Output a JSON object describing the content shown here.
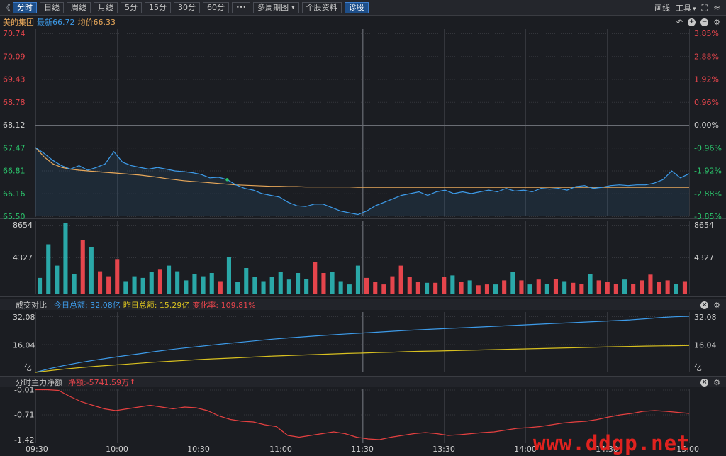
{
  "toolbar": {
    "collapse_glyph": "《",
    "tabs": [
      "分时",
      "日线",
      "周线",
      "月线",
      "5分",
      "15分",
      "30分",
      "60分"
    ],
    "more_glyph": "•••",
    "multi_period": "多周期图",
    "stock_info": "个股资料",
    "diagnose": "诊股",
    "draw": "画线",
    "tools": "工具",
    "dropdown_glyph": "▾"
  },
  "stock": {
    "name": "美的集团",
    "latest_label": "最新66.72",
    "avg_label": "均价66.33"
  },
  "price_axis": {
    "left_labels": [
      "70.74",
      "70.09",
      "69.43",
      "68.78",
      "68.12",
      "67.47",
      "66.81",
      "66.16",
      "65.50"
    ],
    "right_labels": [
      "3.85%",
      "2.88%",
      "1.92%",
      "0.96%",
      "0.00%",
      "-0.96%",
      "-1.92%",
      "-2.88%",
      "-3.85%"
    ]
  },
  "volume_axis": {
    "labels": [
      "8654",
      "4327"
    ]
  },
  "turnover_panel": {
    "title": "成交对比",
    "today": "今日总额: 32.08亿",
    "yesterday": "昨日总额: 15.29亿",
    "change": "变化率: 109.81%",
    "axis_labels": [
      "32.08",
      "16.04",
      "亿"
    ]
  },
  "flow_panel": {
    "title": "分时主力净额",
    "net": "净额:-5741.59万",
    "arrow": "⬆",
    "axis_labels": [
      "-0.01",
      "-0.71",
      "-1.42"
    ]
  },
  "time_labels": [
    "09:30",
    "10:00",
    "10:30",
    "11:00",
    "11:30",
    "13:30",
    "14:00",
    "14:30",
    "15:00"
  ],
  "watermark": "www.ddgp.net",
  "colors": {
    "price_line": "#3d9be9",
    "avg_line": "#e8a85a",
    "up": "#e5454c",
    "down": "#2aa8a8",
    "flow_line": "#e54040",
    "today_line": "#3d9be9",
    "yesterday_line": "#d8c020"
  },
  "chart_data": [
    {
      "type": "line",
      "series": [
        {
          "name": "最新",
          "values": [
            67.47,
            67.3,
            67.1,
            66.95,
            66.85,
            66.95,
            66.82,
            66.9,
            67.0,
            67.35,
            67.05,
            66.95,
            66.9,
            66.85,
            66.9,
            66.85,
            66.8,
            66.78,
            66.75,
            66.7,
            66.6,
            66.62,
            66.55,
            66.4,
            66.3,
            66.25,
            66.15,
            66.1,
            66.05,
            65.9,
            65.8,
            65.78,
            65.85,
            65.85,
            65.75,
            65.65,
            65.6,
            65.55,
            65.65,
            65.8,
            65.9,
            66.0,
            66.1,
            66.15,
            66.2,
            66.1,
            66.2,
            66.25,
            66.15,
            66.2,
            66.15,
            66.2,
            66.25,
            66.2,
            66.3,
            66.22,
            66.25,
            66.2,
            66.3,
            66.28,
            66.3,
            66.25,
            66.35,
            66.38,
            66.3,
            66.33,
            66.38,
            66.4,
            66.38,
            66.4,
            66.4,
            66.45,
            66.55,
            66.8,
            66.6,
            66.72
          ]
        },
        {
          "name": "均价",
          "values": [
            67.47,
            67.2,
            67.0,
            66.9,
            66.85,
            66.82,
            66.8,
            66.78,
            66.76,
            66.74,
            66.72,
            66.7,
            66.68,
            66.65,
            66.62,
            66.58,
            66.55,
            66.52,
            66.5,
            66.48,
            66.46,
            66.44,
            66.42,
            66.4,
            66.39,
            66.38,
            66.37,
            66.36,
            66.36,
            66.35,
            66.35,
            66.34,
            66.34,
            66.34,
            66.34,
            66.34,
            66.34,
            66.33,
            66.33,
            66.33,
            66.33,
            66.33,
            66.33,
            66.33,
            66.33,
            66.33,
            66.33,
            66.33,
            66.33,
            66.33,
            66.33,
            66.33,
            66.33,
            66.33,
            66.33,
            66.33,
            66.33,
            66.33,
            66.33,
            66.33,
            66.33,
            66.33,
            66.33,
            66.33,
            66.33,
            66.33,
            66.33,
            66.33,
            66.33,
            66.33,
            66.33,
            66.33,
            66.33,
            66.33,
            66.33,
            66.33
          ]
        }
      ],
      "ylim": [
        65.5,
        70.74
      ]
    },
    {
      "type": "bar",
      "values": [
        2000,
        6100,
        3500,
        8654,
        2500,
        6600,
        5800,
        2800,
        2200,
        4300,
        1600,
        2200,
        2000,
        2700,
        3000,
        3500,
        2800,
        1700,
        2500,
        2200,
        2600,
        1600,
        4500,
        1500,
        3200,
        2100,
        1600,
        2100,
        2700,
        1800,
        2600,
        1900,
        3900,
        2600,
        2700,
        1600,
        1200,
        3500,
        2000,
        1500,
        1200,
        2200,
        3500,
        2100,
        1500,
        1400,
        1400,
        2100,
        2300,
        1500,
        1700,
        1100,
        1200,
        1200,
        1700,
        2700,
        1700,
        1200,
        1800,
        1300,
        1900,
        1600,
        1400,
        1300,
        2500,
        1700,
        1500,
        1300,
        1800,
        1300,
        1700,
        2400,
        1500,
        1700,
        1300,
        1600
      ],
      "ylim": [
        0,
        8654
      ]
    },
    {
      "type": "line",
      "series": [
        {
          "name": "今日总额",
          "values": [
            0,
            2.2,
            4,
            5.6,
            7,
            8.3,
            9.5,
            10.6,
            11.8,
            12.9,
            13.9,
            14.8,
            15.7,
            16.6,
            17.4,
            18.2,
            19,
            19.7,
            20.3,
            20.9,
            21.5,
            22,
            22.5,
            23,
            23.5,
            24,
            24.4,
            24.8,
            25.2,
            25.6,
            26,
            26.4,
            26.8,
            27.2,
            27.6,
            28,
            28.4,
            28.8,
            29.2,
            29.6,
            30,
            30.6,
            31.3,
            31.8,
            32.08
          ]
        },
        {
          "name": "昨日总额",
          "values": [
            0,
            1,
            1.9,
            2.7,
            3.4,
            4,
            4.6,
            5.2,
            5.8,
            6.3,
            6.8,
            7.3,
            7.7,
            8.1,
            8.5,
            8.9,
            9.3,
            9.6,
            9.9,
            10.2,
            10.5,
            10.8,
            11,
            11.3,
            11.5,
            11.8,
            12,
            12.2,
            12.4,
            12.6,
            12.8,
            13,
            13.2,
            13.4,
            13.6,
            13.8,
            14,
            14.2,
            14.4,
            14.6,
            14.8,
            15,
            15.1,
            15.2,
            15.29
          ]
        }
      ],
      "ylim": [
        0,
        32.08
      ]
    },
    {
      "type": "line",
      "series": [
        {
          "values": [
            -0.01,
            -0.01,
            -0.03,
            -0.2,
            -0.35,
            -0.45,
            -0.55,
            -0.6,
            -0.55,
            -0.5,
            -0.45,
            -0.5,
            -0.55,
            -0.5,
            -0.52,
            -0.6,
            -0.75,
            -0.85,
            -0.9,
            -0.92,
            -1.0,
            -1.05,
            -1.3,
            -1.35,
            -1.3,
            -1.25,
            -1.2,
            -1.25,
            -1.35,
            -1.4,
            -1.42,
            -1.35,
            -1.3,
            -1.25,
            -1.22,
            -1.25,
            -1.3,
            -1.28,
            -1.25,
            -1.22,
            -1.2,
            -1.15,
            -1.1,
            -1.08,
            -1.05,
            -1.0,
            -0.95,
            -0.92,
            -0.9,
            -0.85,
            -0.78,
            -0.72,
            -0.68,
            -0.62,
            -0.6,
            -0.62,
            -0.65,
            -0.68
          ]
        }
      ],
      "ylim": [
        -1.5,
        0
      ]
    }
  ]
}
